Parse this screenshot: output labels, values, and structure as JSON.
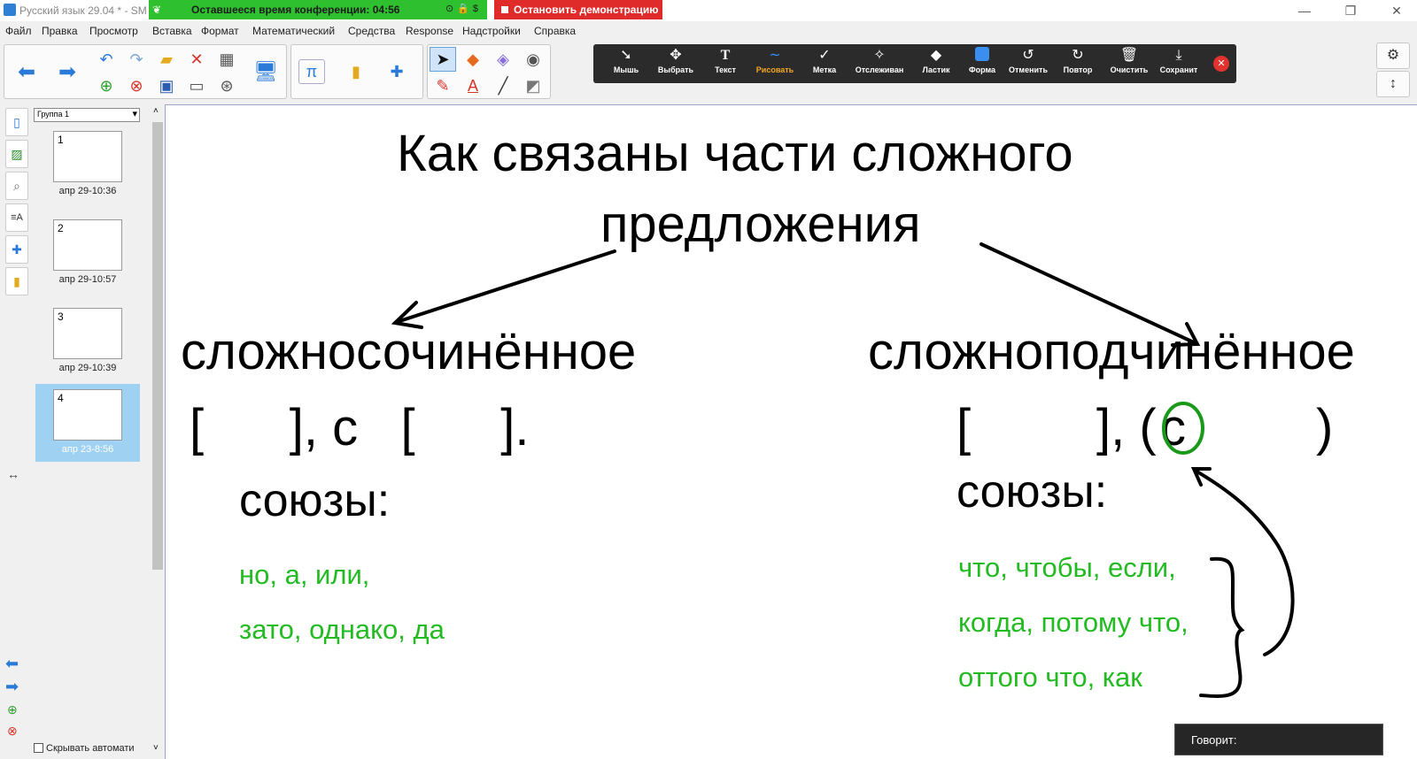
{
  "window": {
    "title": "Русский язык 29.04 * - SM",
    "controls": [
      "—",
      "❐",
      "✕"
    ]
  },
  "zoom": {
    "timer": "Оставшееся время конференции: 04:56",
    "stop_button": "Остановить демонстрацию"
  },
  "menu": [
    "Файл",
    "Правка",
    "Просмотр",
    "Вставка",
    "Формат",
    "Математический",
    "Средства",
    "Response",
    "Надстройки",
    "Справка"
  ],
  "annotate": {
    "tools": [
      {
        "label": "Мышь",
        "icon": "cursor-icon"
      },
      {
        "label": "Выбрать",
        "icon": "move-icon"
      },
      {
        "label": "Текст",
        "icon": "text-icon"
      },
      {
        "label": "Рисовать",
        "icon": "draw-icon"
      },
      {
        "label": "Метка",
        "icon": "checkmark-icon"
      },
      {
        "label": "Отслеживан",
        "icon": "spotlight-icon"
      },
      {
        "label": "Ластик",
        "icon": "eraser-icon"
      },
      {
        "label": "Форма",
        "icon": "shape-icon"
      },
      {
        "label": "Отменить",
        "icon": "undo-icon"
      },
      {
        "label": "Повтор",
        "icon": "redo-icon"
      },
      {
        "label": "Очистить",
        "icon": "trash-icon"
      },
      {
        "label": "Сохранит",
        "icon": "save-icon"
      }
    ],
    "active_tool": "Рисовать",
    "active_color": "#f5a623"
  },
  "sidebar": {
    "group": "Группа 1",
    "slides": [
      {
        "num": "1",
        "caption": "апр 29-10:36"
      },
      {
        "num": "2",
        "caption": "апр 29-10:57"
      },
      {
        "num": "3",
        "caption": "апр 29-10:39"
      },
      {
        "num": "4",
        "caption": "апр 23-8:56"
      }
    ],
    "hide_auto": "Скрывать автомати"
  },
  "slide": {
    "title_line1": "Как связаны части сложного",
    "title_line2": "предложения",
    "left": {
      "heading": "сложносочинённое",
      "scheme": "[      ], с   [      ].",
      "unions_label": "союзы:",
      "unions": [
        "но, а, или,",
        "зато, однако, да"
      ]
    },
    "right": {
      "heading": "сложноподчинённое",
      "scheme_open": "[",
      "scheme_mid": "], (",
      "scheme_c": "с",
      "scheme_close": ")",
      "unions_label": "союзы:",
      "unions": [
        "что, чтобы, если,",
        "когда, потому что,",
        "оттого что, как"
      ]
    },
    "colors": {
      "text": "#000000",
      "green": "#22bb22",
      "circle": "#1a9a1a"
    }
  },
  "speaking_label": "Говорит:"
}
